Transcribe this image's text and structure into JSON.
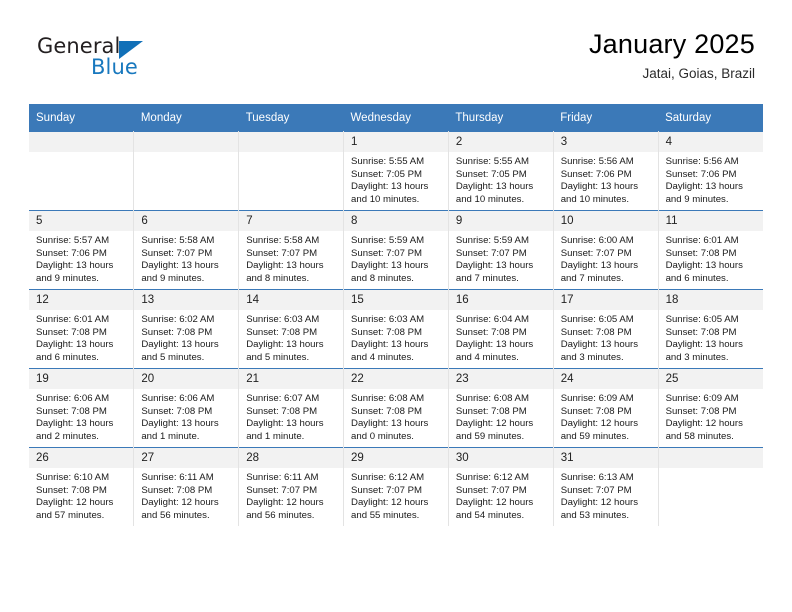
{
  "brand": {
    "name_part1": "General",
    "name_part2": "Blue",
    "accent_color": "#1170b8",
    "text_color": "#231f20"
  },
  "header": {
    "title": "January 2025",
    "subtitle": "Jatai, Goias, Brazil"
  },
  "theme": {
    "header_bg": "#3b79b8",
    "daynum_bg": "#f2f2f2",
    "grid_line": "#e3e3e3",
    "row_line": "#3b79b8"
  },
  "weekdays": [
    "Sunday",
    "Monday",
    "Tuesday",
    "Wednesday",
    "Thursday",
    "Friday",
    "Saturday"
  ],
  "weeks": [
    [
      {
        "day": "",
        "sunrise": "",
        "sunset": "",
        "daylight": "",
        "empty": true
      },
      {
        "day": "",
        "sunrise": "",
        "sunset": "",
        "daylight": "",
        "empty": true
      },
      {
        "day": "",
        "sunrise": "",
        "sunset": "",
        "daylight": "",
        "empty": true
      },
      {
        "day": "1",
        "sunrise": "Sunrise: 5:55 AM",
        "sunset": "Sunset: 7:05 PM",
        "daylight": "Daylight: 13 hours and 10 minutes."
      },
      {
        "day": "2",
        "sunrise": "Sunrise: 5:55 AM",
        "sunset": "Sunset: 7:05 PM",
        "daylight": "Daylight: 13 hours and 10 minutes."
      },
      {
        "day": "3",
        "sunrise": "Sunrise: 5:56 AM",
        "sunset": "Sunset: 7:06 PM",
        "daylight": "Daylight: 13 hours and 10 minutes."
      },
      {
        "day": "4",
        "sunrise": "Sunrise: 5:56 AM",
        "sunset": "Sunset: 7:06 PM",
        "daylight": "Daylight: 13 hours and 9 minutes."
      }
    ],
    [
      {
        "day": "5",
        "sunrise": "Sunrise: 5:57 AM",
        "sunset": "Sunset: 7:06 PM",
        "daylight": "Daylight: 13 hours and 9 minutes."
      },
      {
        "day": "6",
        "sunrise": "Sunrise: 5:58 AM",
        "sunset": "Sunset: 7:07 PM",
        "daylight": "Daylight: 13 hours and 9 minutes."
      },
      {
        "day": "7",
        "sunrise": "Sunrise: 5:58 AM",
        "sunset": "Sunset: 7:07 PM",
        "daylight": "Daylight: 13 hours and 8 minutes."
      },
      {
        "day": "8",
        "sunrise": "Sunrise: 5:59 AM",
        "sunset": "Sunset: 7:07 PM",
        "daylight": "Daylight: 13 hours and 8 minutes."
      },
      {
        "day": "9",
        "sunrise": "Sunrise: 5:59 AM",
        "sunset": "Sunset: 7:07 PM",
        "daylight": "Daylight: 13 hours and 7 minutes."
      },
      {
        "day": "10",
        "sunrise": "Sunrise: 6:00 AM",
        "sunset": "Sunset: 7:07 PM",
        "daylight": "Daylight: 13 hours and 7 minutes."
      },
      {
        "day": "11",
        "sunrise": "Sunrise: 6:01 AM",
        "sunset": "Sunset: 7:08 PM",
        "daylight": "Daylight: 13 hours and 6 minutes."
      }
    ],
    [
      {
        "day": "12",
        "sunrise": "Sunrise: 6:01 AM",
        "sunset": "Sunset: 7:08 PM",
        "daylight": "Daylight: 13 hours and 6 minutes."
      },
      {
        "day": "13",
        "sunrise": "Sunrise: 6:02 AM",
        "sunset": "Sunset: 7:08 PM",
        "daylight": "Daylight: 13 hours and 5 minutes."
      },
      {
        "day": "14",
        "sunrise": "Sunrise: 6:03 AM",
        "sunset": "Sunset: 7:08 PM",
        "daylight": "Daylight: 13 hours and 5 minutes."
      },
      {
        "day": "15",
        "sunrise": "Sunrise: 6:03 AM",
        "sunset": "Sunset: 7:08 PM",
        "daylight": "Daylight: 13 hours and 4 minutes."
      },
      {
        "day": "16",
        "sunrise": "Sunrise: 6:04 AM",
        "sunset": "Sunset: 7:08 PM",
        "daylight": "Daylight: 13 hours and 4 minutes."
      },
      {
        "day": "17",
        "sunrise": "Sunrise: 6:05 AM",
        "sunset": "Sunset: 7:08 PM",
        "daylight": "Daylight: 13 hours and 3 minutes."
      },
      {
        "day": "18",
        "sunrise": "Sunrise: 6:05 AM",
        "sunset": "Sunset: 7:08 PM",
        "daylight": "Daylight: 13 hours and 3 minutes."
      }
    ],
    [
      {
        "day": "19",
        "sunrise": "Sunrise: 6:06 AM",
        "sunset": "Sunset: 7:08 PM",
        "daylight": "Daylight: 13 hours and 2 minutes."
      },
      {
        "day": "20",
        "sunrise": "Sunrise: 6:06 AM",
        "sunset": "Sunset: 7:08 PM",
        "daylight": "Daylight: 13 hours and 1 minute."
      },
      {
        "day": "21",
        "sunrise": "Sunrise: 6:07 AM",
        "sunset": "Sunset: 7:08 PM",
        "daylight": "Daylight: 13 hours and 1 minute."
      },
      {
        "day": "22",
        "sunrise": "Sunrise: 6:08 AM",
        "sunset": "Sunset: 7:08 PM",
        "daylight": "Daylight: 13 hours and 0 minutes."
      },
      {
        "day": "23",
        "sunrise": "Sunrise: 6:08 AM",
        "sunset": "Sunset: 7:08 PM",
        "daylight": "Daylight: 12 hours and 59 minutes."
      },
      {
        "day": "24",
        "sunrise": "Sunrise: 6:09 AM",
        "sunset": "Sunset: 7:08 PM",
        "daylight": "Daylight: 12 hours and 59 minutes."
      },
      {
        "day": "25",
        "sunrise": "Sunrise: 6:09 AM",
        "sunset": "Sunset: 7:08 PM",
        "daylight": "Daylight: 12 hours and 58 minutes."
      }
    ],
    [
      {
        "day": "26",
        "sunrise": "Sunrise: 6:10 AM",
        "sunset": "Sunset: 7:08 PM",
        "daylight": "Daylight: 12 hours and 57 minutes."
      },
      {
        "day": "27",
        "sunrise": "Sunrise: 6:11 AM",
        "sunset": "Sunset: 7:08 PM",
        "daylight": "Daylight: 12 hours and 56 minutes."
      },
      {
        "day": "28",
        "sunrise": "Sunrise: 6:11 AM",
        "sunset": "Sunset: 7:07 PM",
        "daylight": "Daylight: 12 hours and 56 minutes."
      },
      {
        "day": "29",
        "sunrise": "Sunrise: 6:12 AM",
        "sunset": "Sunset: 7:07 PM",
        "daylight": "Daylight: 12 hours and 55 minutes."
      },
      {
        "day": "30",
        "sunrise": "Sunrise: 6:12 AM",
        "sunset": "Sunset: 7:07 PM",
        "daylight": "Daylight: 12 hours and 54 minutes."
      },
      {
        "day": "31",
        "sunrise": "Sunrise: 6:13 AM",
        "sunset": "Sunset: 7:07 PM",
        "daylight": "Daylight: 12 hours and 53 minutes."
      },
      {
        "day": "",
        "sunrise": "",
        "sunset": "",
        "daylight": "",
        "empty": true
      }
    ]
  ]
}
